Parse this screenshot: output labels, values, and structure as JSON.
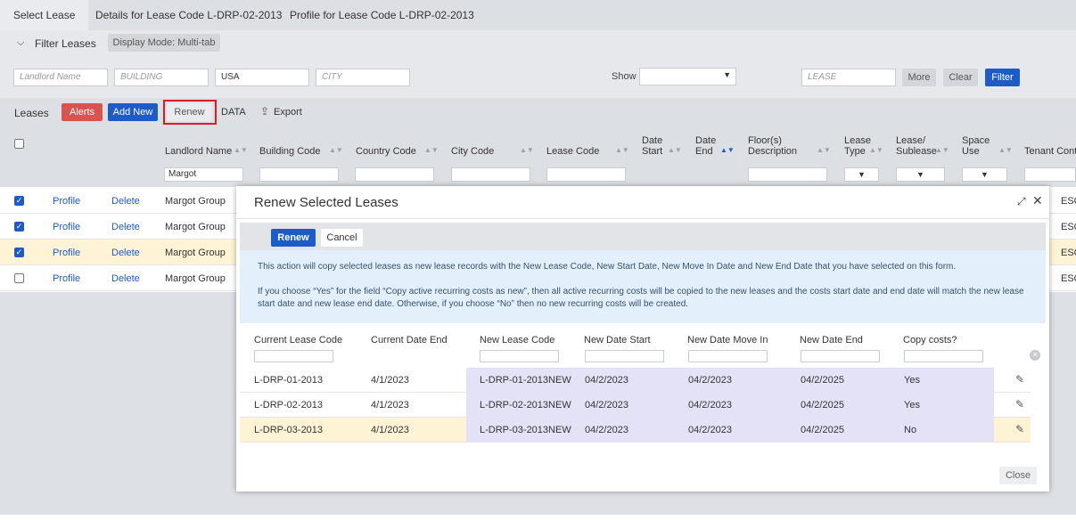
{
  "tabs": [
    {
      "label": "Select Lease"
    },
    {
      "label": "Details for Lease Code L-DRP-02-2013"
    },
    {
      "label": "Profile for Lease Code L-DRP-02-2013"
    }
  ],
  "filter": {
    "toggle_label": "Filter Leases",
    "display_mode": "Display Mode: Multi-tab",
    "landlord_placeholder": "Landlord Name",
    "building_placeholder": "BUILDING",
    "country_value": "USA",
    "city_placeholder": "CITY",
    "show_label": "Show",
    "lease_placeholder": "LEASE",
    "more_label": "More",
    "clear_label": "Clear",
    "filter_label": "Filter"
  },
  "leases_toolbar": {
    "title": "Leases",
    "alerts": "Alerts",
    "add_new": "Add New",
    "renew": "Renew",
    "data": "DATA",
    "export": "Export"
  },
  "grid": {
    "columns": {
      "landlord": "Landlord Name",
      "building": "Building Code",
      "country": "Country Code",
      "city": "City Code",
      "lease": "Lease Code",
      "date_start_1": "Date",
      "date_start_2": "Start",
      "date_end_1": "Date",
      "date_end_2": "End",
      "floors_1": "Floor(s)",
      "floors_2": "Description",
      "lease_type_1": "Lease",
      "lease_type_2": "Type",
      "sublease_1": "Lease/",
      "sublease_2": "Sublease",
      "space_1": "Space",
      "space_2": "Use",
      "tenant": "Tenant Cont"
    },
    "landlord_filter": "Margot",
    "rows": [
      {
        "profile": "Profile",
        "delete": "Delete",
        "landlord": "Margot Group",
        "right": "ESQU",
        "checked": true
      },
      {
        "profile": "Profile",
        "delete": "Delete",
        "landlord": "Margot Group",
        "right": "ESQU",
        "checked": true
      },
      {
        "profile": "Profile",
        "delete": "Delete",
        "landlord": "Margot Group",
        "right": "ESQU",
        "checked": true
      },
      {
        "profile": "Profile",
        "delete": "Delete",
        "landlord": "Margot Group",
        "right": "ESQU",
        "checked": false
      }
    ]
  },
  "modal": {
    "title": "Renew Selected Leases",
    "renew_label": "Renew",
    "cancel_label": "Cancel",
    "info_1": "This action will copy selected leases as new lease records with the New Lease Code, New Start Date, New Move In Date and New End Date that you have selected on this form.",
    "info_2": "If you choose “Yes” for the field “Copy active recurring costs as new”, then all active recurring costs will be copied to the new leases and the costs start date and end date will match the new lease start date and new lease end date. Otherwise, if you choose “No” then no new recurring costs will be created.",
    "columns": {
      "current_code": "Current Lease Code",
      "current_end": "Current Date End",
      "new_code": "New Lease Code",
      "new_start": "New Date Start",
      "new_move_in": "New Date Move In",
      "new_end": "New Date End",
      "copy_costs": "Copy costs?"
    },
    "rows": [
      {
        "current_code": "L-DRP-01-2013",
        "current_end": "4/1/2023",
        "new_code": "L-DRP-01-2013NEW",
        "new_start": "04/2/2023",
        "new_move_in": "04/2/2023",
        "new_end": "04/2/2025",
        "copy_costs": "Yes"
      },
      {
        "current_code": "L-DRP-02-2013",
        "current_end": "4/1/2023",
        "new_code": "L-DRP-02-2013NEW",
        "new_start": "04/2/2023",
        "new_move_in": "04/2/2023",
        "new_end": "04/2/2025",
        "copy_costs": "Yes"
      },
      {
        "current_code": "L-DRP-03-2013",
        "current_end": "4/1/2023",
        "new_code": "L-DRP-03-2013NEW",
        "new_start": "04/2/2023",
        "new_move_in": "04/2/2023",
        "new_end": "04/2/2025",
        "copy_costs": "No"
      }
    ],
    "close_label": "Close"
  }
}
